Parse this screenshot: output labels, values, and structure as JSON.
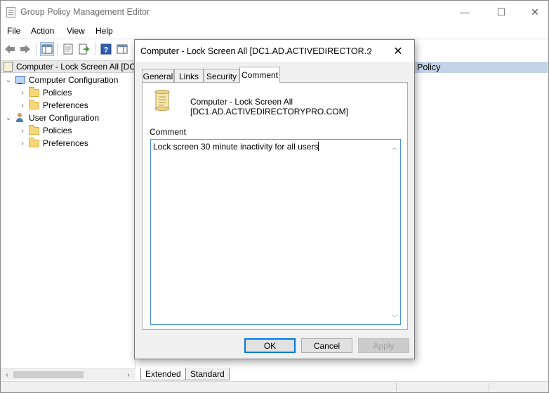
{
  "window": {
    "title": "Group Policy Management Editor",
    "minimize_glyph": "—",
    "maximize_glyph": "☐",
    "close_glyph": "✕"
  },
  "menu": [
    "File",
    "Action",
    "View",
    "Help"
  ],
  "tree": {
    "root": "Computer - Lock Screen All [DC",
    "computer_config": "Computer Configuration",
    "cc_policies": "Policies",
    "cc_preferences": "Preferences",
    "user_config": "User Configuration",
    "uc_policies": "Policies",
    "uc_preferences": "Preferences"
  },
  "right_pane": {
    "header": "Policy"
  },
  "bottom_tabs": [
    "Extended",
    "Standard"
  ],
  "dialog": {
    "title": "Computer - Lock Screen All [DC1.AD.ACTIVEDIRECTOR...",
    "help_glyph": "?",
    "close_glyph": "✕",
    "tabs": [
      "General",
      "Links",
      "Security",
      "Comment"
    ],
    "active_tab": "Comment",
    "gpo_name_line1": "Computer - Lock Screen All",
    "gpo_name_line2": "[DC1.AD.ACTIVEDIRECTORYPRO.COM]",
    "comment_label": "Comment",
    "comment_value": "Lock screen 30 minute inactivity for all users",
    "ok_label": "OK",
    "cancel_label": "Cancel",
    "apply_label": "Apply"
  },
  "colors": {
    "accent": "#0078d7",
    "selection": "#c3d3e8",
    "folder": "#f5d77a"
  }
}
